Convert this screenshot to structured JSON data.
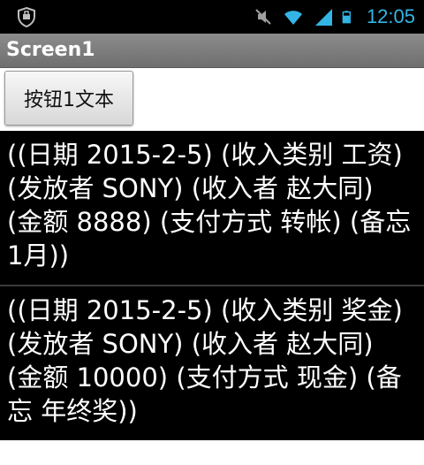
{
  "status_bar": {
    "time": "12:05",
    "icons": [
      "shield-notification-icon",
      "mute-icon",
      "wifi-icon",
      "cell-signal-icon",
      "battery-icon"
    ],
    "time_color": "#33b5e5"
  },
  "title_bar": {
    "title": "Screen1"
  },
  "button": {
    "label": "按钮1文本"
  },
  "list": {
    "items": [
      {
        "text": "((日期 2015-2-5) (收入类别 工资) (发放者 SONY) (收入者 赵大同) (金额 8888) (支付方式 转帐) (备忘 1月))"
      },
      {
        "text": "((日期 2015-2-5) (收入类别 奖金) (发放者 SONY) (收入者 赵大同) (金额 10000) (支付方式 现金) (备忘 年终奖))"
      }
    ]
  }
}
